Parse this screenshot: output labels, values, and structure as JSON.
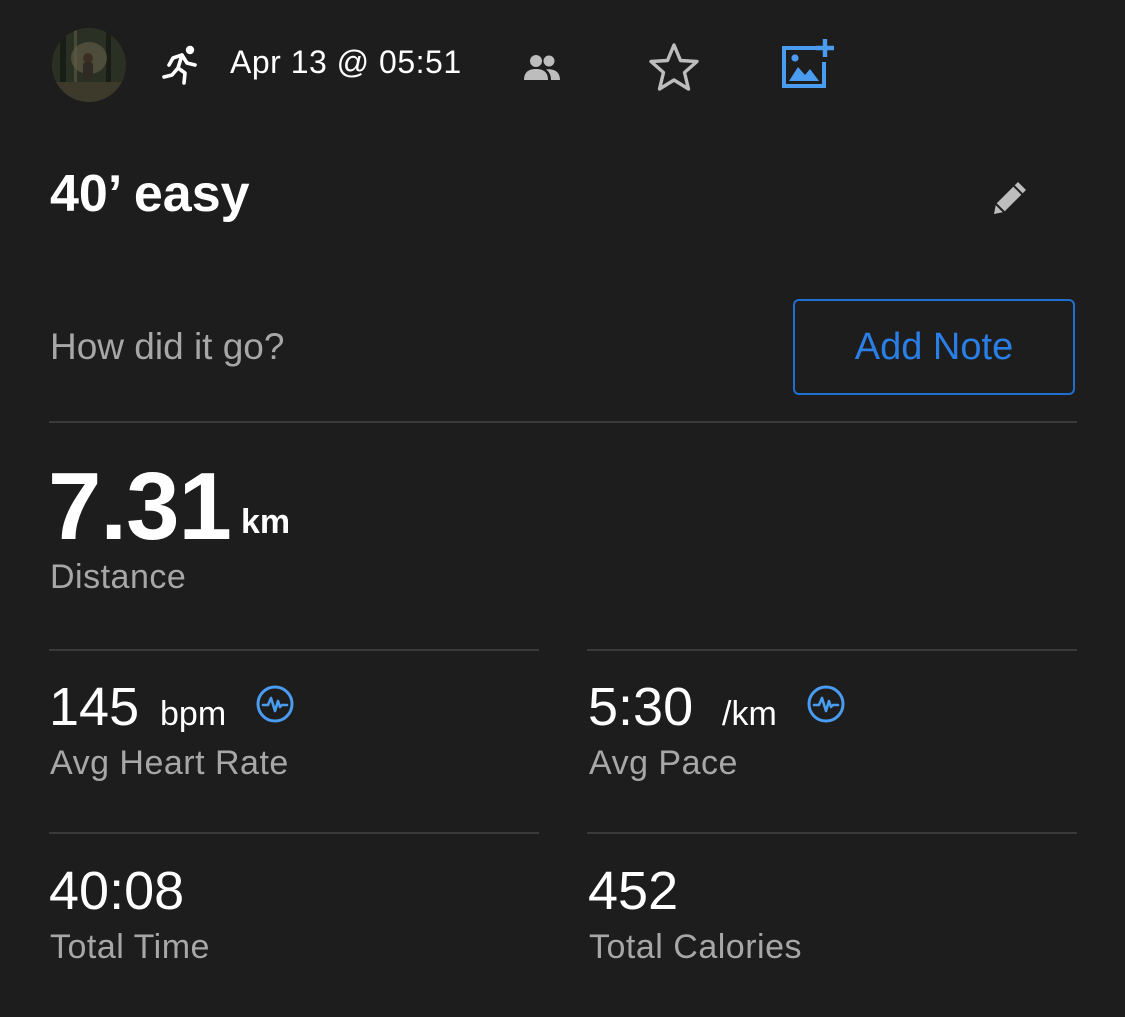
{
  "header": {
    "date_time": "Apr 13 @ 05:51",
    "icons": [
      "avatar",
      "running-icon",
      "people-icon",
      "star-icon",
      "add-photo-icon"
    ]
  },
  "activity": {
    "title": "40’ easy"
  },
  "note": {
    "prompt": "How did it go?",
    "button_label": "Add Note"
  },
  "distance": {
    "value": "7.31",
    "unit": "km",
    "label": "Distance"
  },
  "heart_rate": {
    "value": "145",
    "unit": "bpm",
    "label": "Avg Heart Rate"
  },
  "pace": {
    "value": "5:30",
    "unit": "/km",
    "label": "Avg Pace"
  },
  "total_time": {
    "value": "40:08",
    "label": "Total Time"
  },
  "calories": {
    "value": "452",
    "label": "Total Calories"
  },
  "colors": {
    "background": "#1d1d1d",
    "accent": "#2a7fe6",
    "secondary_text": "#a7a7a7",
    "divider": "#3a3a3a"
  }
}
